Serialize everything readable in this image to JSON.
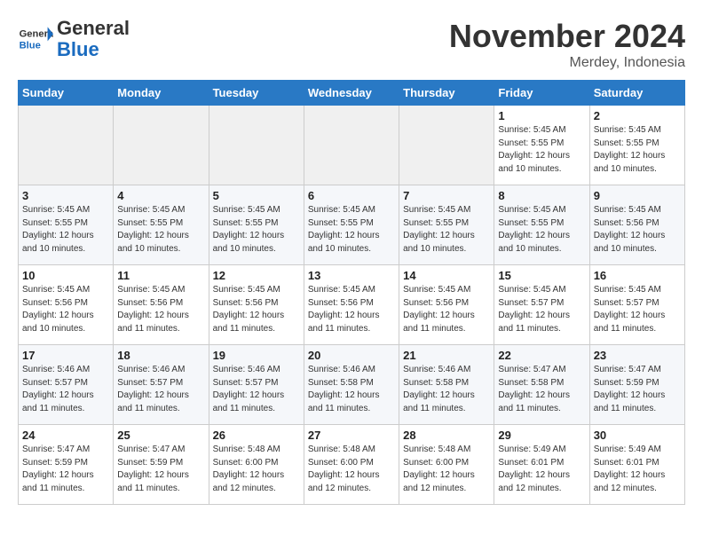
{
  "header": {
    "logo_line1": "General",
    "logo_line2": "Blue",
    "month": "November 2024",
    "location": "Merdey, Indonesia"
  },
  "weekdays": [
    "Sunday",
    "Monday",
    "Tuesday",
    "Wednesday",
    "Thursday",
    "Friday",
    "Saturday"
  ],
  "weeks": [
    [
      {
        "day": "",
        "info": ""
      },
      {
        "day": "",
        "info": ""
      },
      {
        "day": "",
        "info": ""
      },
      {
        "day": "",
        "info": ""
      },
      {
        "day": "",
        "info": ""
      },
      {
        "day": "1",
        "info": "Sunrise: 5:45 AM\nSunset: 5:55 PM\nDaylight: 12 hours\nand 10 minutes."
      },
      {
        "day": "2",
        "info": "Sunrise: 5:45 AM\nSunset: 5:55 PM\nDaylight: 12 hours\nand 10 minutes."
      }
    ],
    [
      {
        "day": "3",
        "info": "Sunrise: 5:45 AM\nSunset: 5:55 PM\nDaylight: 12 hours\nand 10 minutes."
      },
      {
        "day": "4",
        "info": "Sunrise: 5:45 AM\nSunset: 5:55 PM\nDaylight: 12 hours\nand 10 minutes."
      },
      {
        "day": "5",
        "info": "Sunrise: 5:45 AM\nSunset: 5:55 PM\nDaylight: 12 hours\nand 10 minutes."
      },
      {
        "day": "6",
        "info": "Sunrise: 5:45 AM\nSunset: 5:55 PM\nDaylight: 12 hours\nand 10 minutes."
      },
      {
        "day": "7",
        "info": "Sunrise: 5:45 AM\nSunset: 5:55 PM\nDaylight: 12 hours\nand 10 minutes."
      },
      {
        "day": "8",
        "info": "Sunrise: 5:45 AM\nSunset: 5:55 PM\nDaylight: 12 hours\nand 10 minutes."
      },
      {
        "day": "9",
        "info": "Sunrise: 5:45 AM\nSunset: 5:56 PM\nDaylight: 12 hours\nand 10 minutes."
      }
    ],
    [
      {
        "day": "10",
        "info": "Sunrise: 5:45 AM\nSunset: 5:56 PM\nDaylight: 12 hours\nand 10 minutes."
      },
      {
        "day": "11",
        "info": "Sunrise: 5:45 AM\nSunset: 5:56 PM\nDaylight: 12 hours\nand 11 minutes."
      },
      {
        "day": "12",
        "info": "Sunrise: 5:45 AM\nSunset: 5:56 PM\nDaylight: 12 hours\nand 11 minutes."
      },
      {
        "day": "13",
        "info": "Sunrise: 5:45 AM\nSunset: 5:56 PM\nDaylight: 12 hours\nand 11 minutes."
      },
      {
        "day": "14",
        "info": "Sunrise: 5:45 AM\nSunset: 5:56 PM\nDaylight: 12 hours\nand 11 minutes."
      },
      {
        "day": "15",
        "info": "Sunrise: 5:45 AM\nSunset: 5:57 PM\nDaylight: 12 hours\nand 11 minutes."
      },
      {
        "day": "16",
        "info": "Sunrise: 5:45 AM\nSunset: 5:57 PM\nDaylight: 12 hours\nand 11 minutes."
      }
    ],
    [
      {
        "day": "17",
        "info": "Sunrise: 5:46 AM\nSunset: 5:57 PM\nDaylight: 12 hours\nand 11 minutes."
      },
      {
        "day": "18",
        "info": "Sunrise: 5:46 AM\nSunset: 5:57 PM\nDaylight: 12 hours\nand 11 minutes."
      },
      {
        "day": "19",
        "info": "Sunrise: 5:46 AM\nSunset: 5:57 PM\nDaylight: 12 hours\nand 11 minutes."
      },
      {
        "day": "20",
        "info": "Sunrise: 5:46 AM\nSunset: 5:58 PM\nDaylight: 12 hours\nand 11 minutes."
      },
      {
        "day": "21",
        "info": "Sunrise: 5:46 AM\nSunset: 5:58 PM\nDaylight: 12 hours\nand 11 minutes."
      },
      {
        "day": "22",
        "info": "Sunrise: 5:47 AM\nSunset: 5:58 PM\nDaylight: 12 hours\nand 11 minutes."
      },
      {
        "day": "23",
        "info": "Sunrise: 5:47 AM\nSunset: 5:59 PM\nDaylight: 12 hours\nand 11 minutes."
      }
    ],
    [
      {
        "day": "24",
        "info": "Sunrise: 5:47 AM\nSunset: 5:59 PM\nDaylight: 12 hours\nand 11 minutes."
      },
      {
        "day": "25",
        "info": "Sunrise: 5:47 AM\nSunset: 5:59 PM\nDaylight: 12 hours\nand 11 minutes."
      },
      {
        "day": "26",
        "info": "Sunrise: 5:48 AM\nSunset: 6:00 PM\nDaylight: 12 hours\nand 12 minutes."
      },
      {
        "day": "27",
        "info": "Sunrise: 5:48 AM\nSunset: 6:00 PM\nDaylight: 12 hours\nand 12 minutes."
      },
      {
        "day": "28",
        "info": "Sunrise: 5:48 AM\nSunset: 6:00 PM\nDaylight: 12 hours\nand 12 minutes."
      },
      {
        "day": "29",
        "info": "Sunrise: 5:49 AM\nSunset: 6:01 PM\nDaylight: 12 hours\nand 12 minutes."
      },
      {
        "day": "30",
        "info": "Sunrise: 5:49 AM\nSunset: 6:01 PM\nDaylight: 12 hours\nand 12 minutes."
      }
    ]
  ]
}
